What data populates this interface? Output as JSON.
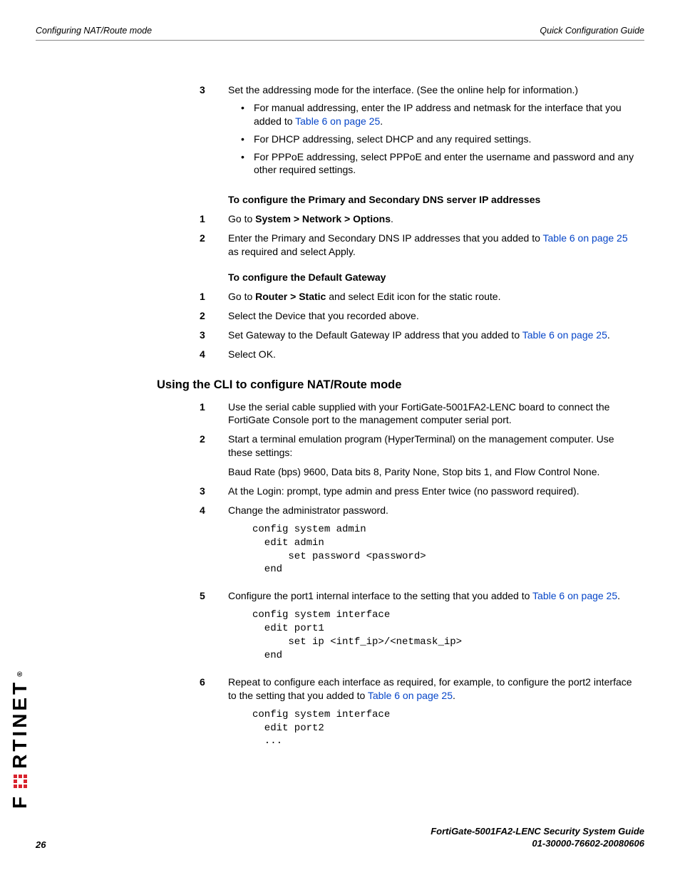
{
  "header": {
    "left": "Configuring NAT/Route mode",
    "right": "Quick Configuration Guide"
  },
  "steps_a": {
    "s3": {
      "num": "3",
      "text_a": "Set the addressing mode for the interface. (See the online help for information.)",
      "b1_a": "For manual addressing, enter the IP address and netmask for the interface that you added to ",
      "b1_link": "Table 6 on page 25",
      "b1_c": ".",
      "b2": "For DHCP addressing, select DHCP and any required settings.",
      "b3": "For PPPoE addressing, select PPPoE and enter the username and password and any other required settings."
    }
  },
  "dns": {
    "heading": "To configure the Primary and Secondary DNS server IP addresses",
    "s1_num": "1",
    "s1_a": "Go to ",
    "s1_b": "System > Network > Options",
    "s1_c": ".",
    "s2_num": "2",
    "s2_a": "Enter the Primary and Secondary DNS IP addresses that you added to ",
    "s2_link": "Table 6 on page 25",
    "s2_c": " as required and select Apply."
  },
  "gw": {
    "heading": "To configure the Default Gateway",
    "s1_num": "1",
    "s1_a": "Go to ",
    "s1_b": "Router > Static",
    "s1_c": " and select Edit icon for the static route.",
    "s2_num": "2",
    "s2": "Select the Device that you recorded above.",
    "s3_num": "3",
    "s3_a": "Set Gateway to the Default Gateway IP address that you added to ",
    "s3_link": "Table 6 on page 25",
    "s3_c": ".",
    "s4_num": "4",
    "s4": "Select OK."
  },
  "cli": {
    "heading": "Using the CLI to configure NAT/Route mode",
    "s1_num": "1",
    "s1": "Use the serial cable supplied with your FortiGate-5001FA2-LENC board to connect the FortiGate Console port to the management computer serial port.",
    "s2_num": "2",
    "s2": "Start a terminal emulation program (HyperTerminal) on the management computer. Use these settings:",
    "s2b": "Baud Rate (bps) 9600, Data bits 8, Parity None, Stop bits 1, and Flow Control None.",
    "s3_num": "3",
    "s3": "At the Login: prompt, type admin and press Enter twice (no password required).",
    "s4_num": "4",
    "s4": "Change the administrator password.",
    "code4": "config system admin\n  edit admin\n      set password <password>\n  end",
    "s5_num": "5",
    "s5_a": "Configure the port1 internal interface to the setting that you added to ",
    "s5_link": "Table 6 on page 25",
    "s5_c": ".",
    "code5": "config system interface\n  edit port1\n      set ip <intf_ip>/<netmask_ip>\n  end",
    "s6_num": "6",
    "s6_a": "Repeat to configure each interface as required, for example, to configure the port2 interface to the setting that you added to ",
    "s6_link": "Table 6 on page 25",
    "s6_c": ".",
    "code6": "config system interface\n  edit port2\n  ..."
  },
  "footer": {
    "line1": "FortiGate-5001FA2-LENC   Security System Guide",
    "line2": "01-30000-76602-20080606",
    "page": "26"
  },
  "logo": {
    "text": "F   RTINET"
  }
}
